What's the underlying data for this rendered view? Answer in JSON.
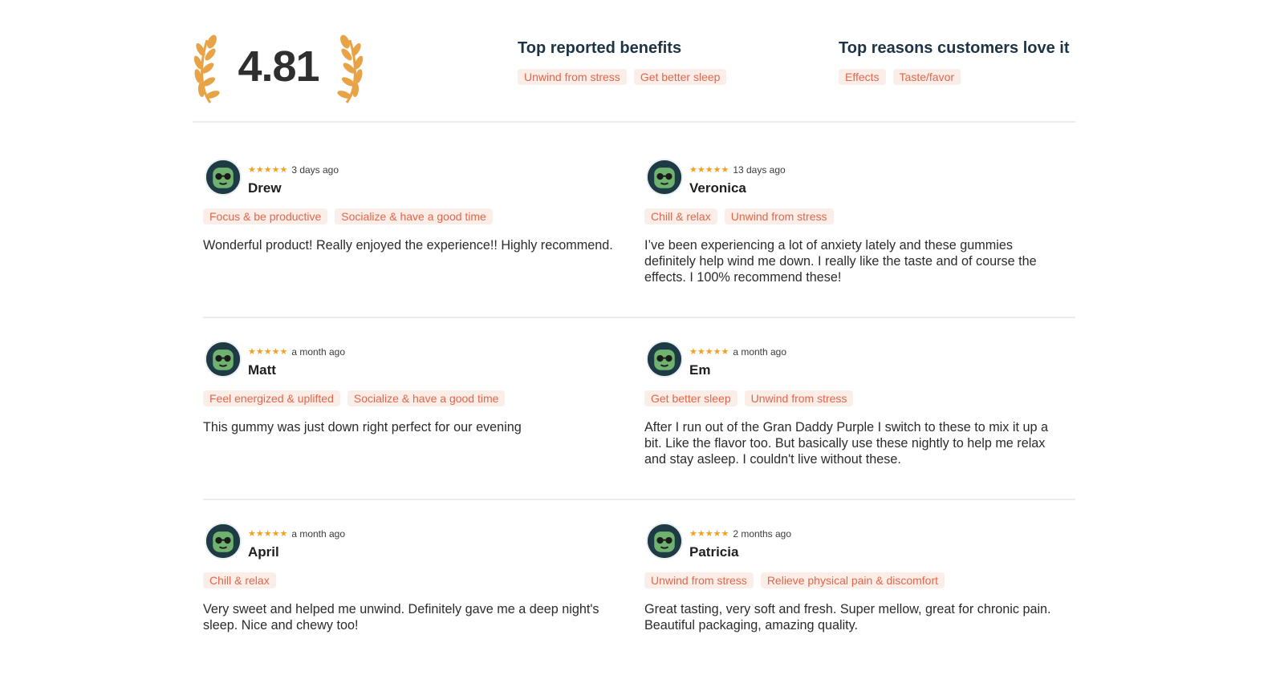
{
  "summary": {
    "rating": "4.81",
    "benefits_title": "Top reported benefits",
    "benefits": [
      "Unwind from stress",
      "Get better sleep"
    ],
    "reasons_title": "Top reasons customers love it",
    "reasons": [
      "Effects",
      "Taste/favor"
    ]
  },
  "colors": {
    "tag_bg": "#fbeee8",
    "tag_text": "#e0664a",
    "star": "#f3a01d",
    "laurel": "#e8a347",
    "heading": "#1d3346"
  },
  "reviews": [
    {
      "name": "Drew",
      "rating": 5,
      "stars": "★★★★★",
      "date": "3 days ago",
      "tags": [
        "Focus & be productive",
        "Socialize & have a good time"
      ],
      "body": "Wonderful product! Really enjoyed the experience!! Highly recommend."
    },
    {
      "name": "Veronica",
      "rating": 5,
      "stars": "★★★★★",
      "date": "13 days ago",
      "tags": [
        "Chill & relax",
        "Unwind from stress"
      ],
      "body": "I’ve been experiencing a lot of anxiety lately and these gummies definitely help wind me down. I really like the taste and of course the effects. I 100% recommend these!"
    },
    {
      "name": "Matt",
      "rating": 5,
      "stars": "★★★★★",
      "date": "a month ago",
      "tags": [
        "Feel energized & uplifted",
        "Socialize & have a good time"
      ],
      "body": "This gummy was just down right perfect for our evening"
    },
    {
      "name": "Em",
      "rating": 5,
      "stars": "★★★★★",
      "date": "a month ago",
      "tags": [
        "Get better sleep",
        "Unwind from stress"
      ],
      "body": "After I run out of the Gran Daddy Purple I switch to these to mix it up a bit. Like the flavor too. But basically use these nightly to help me relax and stay asleep. I couldn't live without these."
    },
    {
      "name": "April",
      "rating": 5,
      "stars": "★★★★★",
      "date": "a month ago",
      "tags": [
        "Chill & relax"
      ],
      "body": "Very sweet and helped me unwind. Definitely gave me a deep night's sleep. Nice and chewy too!"
    },
    {
      "name": "Patricia",
      "rating": 5,
      "stars": "★★★★★",
      "date": "2 months ago",
      "tags": [
        "Unwind from stress",
        "Relieve physical pain & discomfort"
      ],
      "body": "Great tasting, very soft and fresh. Super mellow, great for chronic pain. Beautiful packaging, amazing quality."
    }
  ]
}
